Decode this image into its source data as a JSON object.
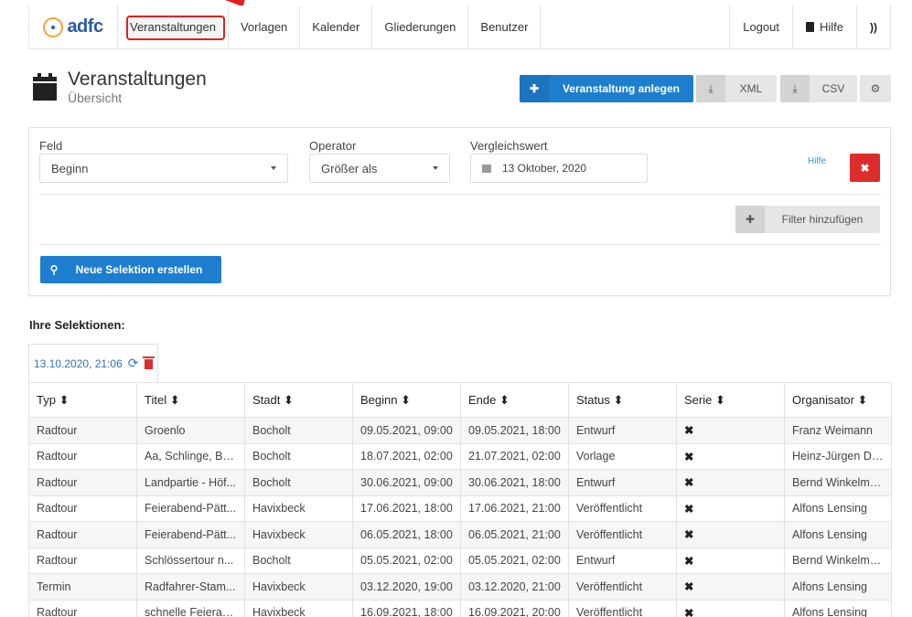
{
  "nav": {
    "logo_text": "adfc",
    "items": [
      {
        "label": "Veranstaltungen",
        "active": true
      },
      {
        "label": "Vorlagen"
      },
      {
        "label": "Kalender"
      },
      {
        "label": "Gliederungen"
      },
      {
        "label": "Benutzer"
      }
    ],
    "logout": "Logout",
    "help": "Hilfe"
  },
  "header": {
    "title": "Veranstaltungen",
    "subtitle": "Übersicht",
    "create_label": "Veranstaltung anlegen",
    "xml_label": "XML",
    "csv_label": "CSV"
  },
  "filter": {
    "field_label": "Feld",
    "field_value": "Beginn",
    "operator_label": "Operator",
    "operator_value": "Größer als",
    "compare_label": "Vergleichswert",
    "compare_value": "13 Oktober, 2020",
    "help_link": "Hilfe",
    "add_filter_label": "Filter hinzufügen",
    "new_selection_label": "Neue Selektion erstellen"
  },
  "selections": {
    "heading": "Ihre Selektionen:",
    "tab_label": "13.10.2020, 21:06"
  },
  "table": {
    "columns": [
      "Typ ⬍",
      "Titel ⬍",
      "Stadt ⬍",
      "Beginn ⬍",
      "Ende ⬍",
      "Status ⬍",
      "Serie ⬍",
      "Organisator ⬍"
    ],
    "rows": [
      [
        "Radtour",
        "Groenlo",
        "Bocholt",
        "09.05.2021, 09:00",
        "09.05.2021, 18:00",
        "Entwurf",
        "✖",
        "Franz Weimann"
      ],
      [
        "Radtour",
        "Aa, Schlinge, Be...",
        "Bocholt",
        "18.07.2021, 02:00",
        "21.07.2021, 02:00",
        "Vorlage",
        "✖",
        "Heinz-Jürgen Dr..."
      ],
      [
        "Radtour",
        "Landpartie - Höf...",
        "Bocholt",
        "30.06.2021, 09:00",
        "30.06.2021, 18:00",
        "Entwurf",
        "✖",
        "Bernd Winkelma..."
      ],
      [
        "Radtour",
        "Feierabend-Pätt...",
        "Havixbeck",
        "17.06.2021, 18:00",
        "17.06.2021, 21:00",
        "Veröffentlicht",
        "✖",
        "Alfons Lensing"
      ],
      [
        "Radtour",
        "Feierabend-Pätt...",
        "Havixbeck",
        "06.05.2021, 18:00",
        "06.05.2021, 21:00",
        "Veröffentlicht",
        "✖",
        "Alfons Lensing"
      ],
      [
        "Radtour",
        "Schlössertour n...",
        "Bocholt",
        "05.05.2021, 02:00",
        "05.05.2021, 02:00",
        "Entwurf",
        "✖",
        "Bernd Winkelma..."
      ],
      [
        "Termin",
        "Radfahrer-Stam...",
        "Havixbeck",
        "03.12.2020, 19:00",
        "03.12.2020, 21:00",
        "Veröffentlicht",
        "✖",
        "Alfons Lensing"
      ],
      [
        "Radtour",
        "schnelle Feierab...",
        "Havixbeck",
        "16.09.2021, 18:00",
        "16.09.2021, 20:00",
        "Veröffentlicht",
        "✖",
        "Alfons Lensing"
      ]
    ]
  },
  "colors": {
    "primary": "#1d7ed0",
    "danger": "#dd2c2c",
    "highlight": "#e02020"
  }
}
